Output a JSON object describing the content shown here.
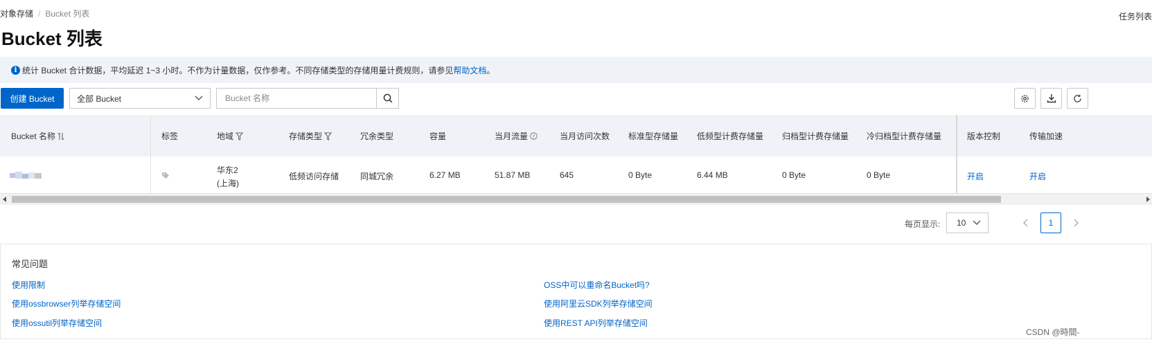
{
  "breadcrumb": {
    "root": "对象存储",
    "separator": "/",
    "current": "Bucket 列表"
  },
  "header": {
    "title": "Bucket 列表",
    "tasks_link": "任务列表"
  },
  "notice": {
    "text": "统计 Bucket 合计数据，平均延迟 1~3 小时。不作为计量数据，仅作参考。不同存储类型的存储用量计费规则，请参见",
    "link": "帮助文档",
    "suffix": "。"
  },
  "toolbar": {
    "create_button": "创建 Bucket",
    "bucket_filter": "全部 Bucket",
    "search_placeholder": "Bucket 名称"
  },
  "table": {
    "columns": [
      "Bucket 名称",
      "标签",
      "地域",
      "存储类型",
      "冗余类型",
      "容量",
      "当月流量",
      "当月访问次数",
      "标准型存储量",
      "低频型计费存储量",
      "归档型计费存储量",
      "冷归档型计费存储量",
      "版本控制",
      "传输加速"
    ],
    "rows": [
      {
        "region_line1": "华东2",
        "region_line2": "(上海)",
        "storage_type": "低频访问存储",
        "redundancy": "同城冗余",
        "capacity": "6.27 MB",
        "monthly_traffic": "51.87 MB",
        "monthly_requests": "645",
        "standard_storage": "0 Byte",
        "ia_storage": "6.44 MB",
        "archive_storage": "0 Byte",
        "cold_archive_storage": "0 Byte",
        "versioning": "开启",
        "acceleration": "开启"
      }
    ]
  },
  "pagination": {
    "page_size_label": "每页显示:",
    "page_size": "10",
    "current_page": "1"
  },
  "faq": {
    "title": "常见问题",
    "left": [
      "使用限制",
      "使用ossbrowser列举存储空间",
      "使用ossutil列举存储空间"
    ],
    "right": [
      "OSS中可以重命名Bucket吗?",
      "使用阿里云SDK列举存储空间",
      "使用REST API列举存储空间"
    ]
  },
  "watermark": "CSDN @時間-",
  "colors": {
    "primary": "#0064c8",
    "header_bg": "#eff3f8"
  }
}
